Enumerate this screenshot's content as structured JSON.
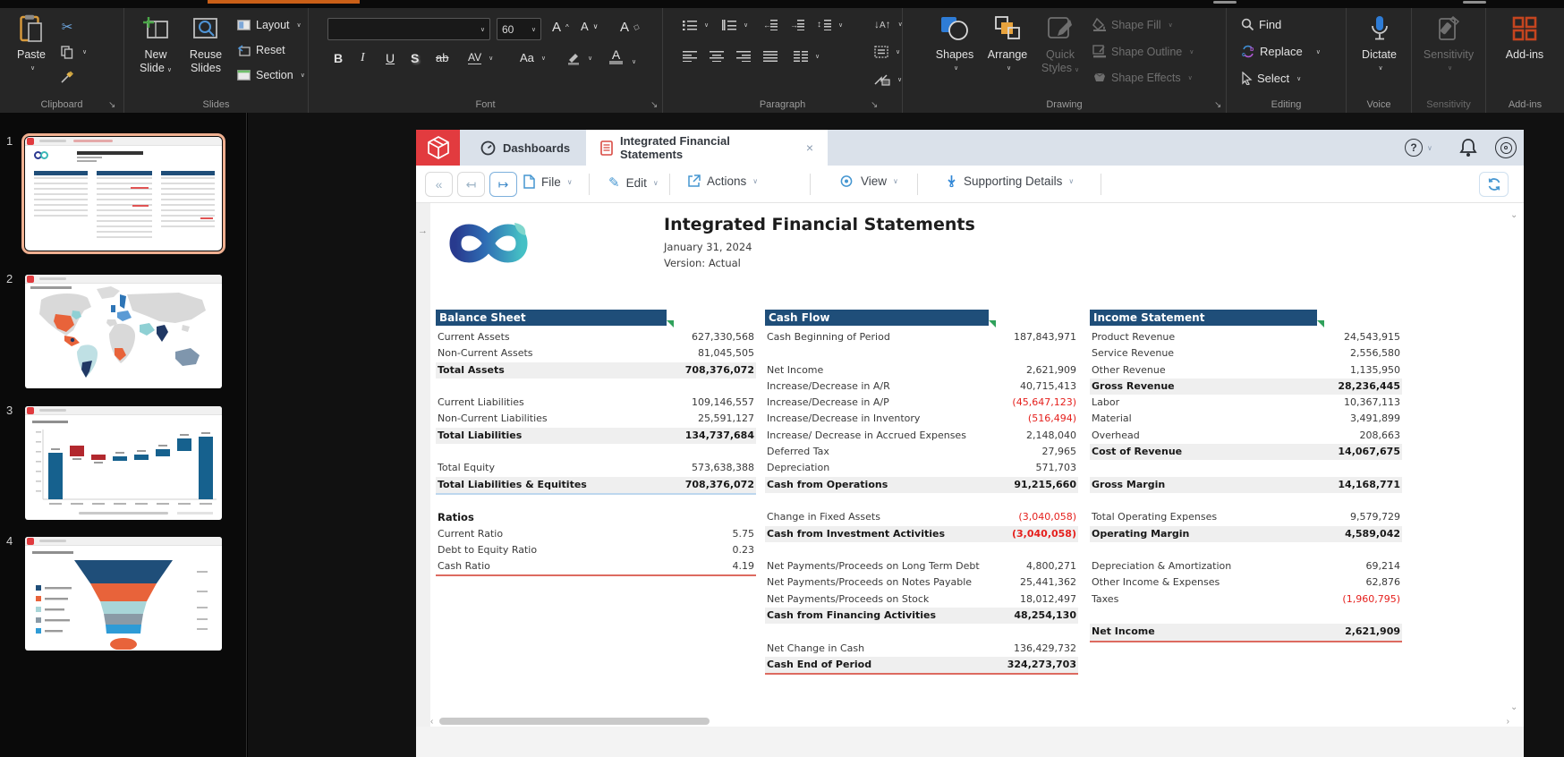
{
  "ribbon": {
    "clipboard": {
      "label": "Clipboard",
      "paste": "Paste"
    },
    "slides": {
      "label": "Slides",
      "new_slide_1": "New",
      "new_slide_2": "Slide",
      "reuse_1": "Reuse",
      "reuse_2": "Slides",
      "layout": "Layout",
      "reset": "Reset",
      "section": "Section"
    },
    "font": {
      "label": "Font",
      "font_name": "",
      "font_size": "60",
      "bold": "B",
      "italic": "I",
      "underline": "U",
      "shadow": "S",
      "strike": "ab",
      "spacing": "AV",
      "case": "Aa"
    },
    "paragraph": {
      "label": "Paragraph"
    },
    "drawing": {
      "label": "Drawing",
      "shapes": "Shapes",
      "arrange": "Arrange",
      "quick_1": "Quick",
      "quick_2": "Styles",
      "shape_fill": "Shape Fill",
      "shape_outline": "Shape Outline",
      "shape_effects": "Shape Effects"
    },
    "editing": {
      "label": "Editing",
      "find": "Find",
      "replace": "Replace",
      "select": "Select"
    },
    "voice": {
      "label": "Voice",
      "dictate": "Dictate"
    },
    "sensitivity": {
      "label": "Sensitivity",
      "button": "Sensitivity"
    },
    "addins": {
      "label": "Add-ins",
      "button": "Add-ins"
    }
  },
  "slide_panel": {
    "slides": [
      {
        "number": "1",
        "selected": true
      },
      {
        "number": "2",
        "selected": false
      },
      {
        "number": "3",
        "selected": false
      },
      {
        "number": "4",
        "selected": false
      }
    ]
  },
  "app": {
    "tabs": [
      {
        "label": "Dashboards"
      },
      {
        "label": "Integrated Financial Statements",
        "close": "×"
      }
    ],
    "toolbar": {
      "back": "«",
      "history_back": "↤",
      "history_forward": "↦",
      "file": "File",
      "edit": "Edit",
      "actions": "Actions",
      "view": "View",
      "supporting_details": "Supporting Details",
      "help": "?"
    },
    "document": {
      "title": "Integrated Financial Statements",
      "date": "January 31, 2024",
      "version": "Version: Actual",
      "statements": [
        {
          "css": "bs",
          "title": "Balance Sheet",
          "rows": [
            {
              "l": "Current Assets",
              "v": "627,330,568"
            },
            {
              "l": "Non-Current Assets",
              "v": "81,045,505"
            },
            {
              "l": "Total Assets",
              "v": "708,376,072",
              "t": 1
            },
            {
              "b": 1
            },
            {
              "l": "Current Liabilities",
              "v": "109,146,557"
            },
            {
              "l": "Non-Current Liabilities",
              "v": "25,591,127"
            },
            {
              "l": "Total Liabilities",
              "v": "134,737,684",
              "t": 1
            },
            {
              "b": 1
            },
            {
              "l": "Total Equity",
              "v": "573,638,388"
            },
            {
              "l": "Total Liabilities & Equitites",
              "v": "708,376,072",
              "t": 1,
              "u": "blue"
            },
            {
              "b": 1
            },
            {
              "l": "Ratios",
              "sub": 1
            },
            {
              "l": "Current Ratio",
              "v": "5.75"
            },
            {
              "l": "Debt to Equity Ratio",
              "v": "0.23"
            },
            {
              "l": "Cash Ratio",
              "v": "4.19",
              "u": "red"
            }
          ]
        },
        {
          "css": "cf",
          "title": "Cash Flow",
          "rows": [
            {
              "l": "Cash Beginning of Period",
              "v": "187,843,971"
            },
            {
              "b": 1
            },
            {
              "l": "Net Income",
              "v": "2,621,909"
            },
            {
              "l": "Increase/Decrease in A/R",
              "v": "40,715,413"
            },
            {
              "l": "Increase/Decrease in A/P",
              "v": "(45,647,123)",
              "neg": 1
            },
            {
              "l": "Increase/Decrease in Inventory",
              "v": "(516,494)",
              "neg": 1
            },
            {
              "l": "Increase/ Decrease in Accrued Expenses",
              "v": "2,148,040"
            },
            {
              "l": "Deferred Tax",
              "v": "27,965"
            },
            {
              "l": "Depreciation",
              "v": "571,703"
            },
            {
              "l": "Cash from Operations",
              "v": "91,215,660",
              "t": 1
            },
            {
              "b": 1
            },
            {
              "l": "Change in Fixed Assets",
              "v": "(3,040,058)",
              "neg": 1
            },
            {
              "l": "Cash from Investment Activities",
              "v": "(3,040,058)",
              "t": 1,
              "neg": 1
            },
            {
              "b": 1
            },
            {
              "l": "Net Payments/Proceeds on Long Term Debt",
              "v": "4,800,271"
            },
            {
              "l": "Net Payments/Proceeds on Notes Payable",
              "v": "25,441,362"
            },
            {
              "l": "Net Payments/Proceeds on Stock",
              "v": "18,012,497"
            },
            {
              "l": "Cash from Financing Activities",
              "v": "48,254,130",
              "t": 1
            },
            {
              "b": 1
            },
            {
              "l": "Net Change in Cash",
              "v": "136,429,732"
            },
            {
              "l": "Cash End of Period",
              "v": "324,273,703",
              "t": 1,
              "u": "red"
            }
          ]
        },
        {
          "css": "is",
          "title": "Income Statement",
          "rows": [
            {
              "l": "Product Revenue",
              "v": "24,543,915"
            },
            {
              "l": "Service Revenue",
              "v": "2,556,580"
            },
            {
              "l": "Other Revenue",
              "v": "1,135,950"
            },
            {
              "l": "Gross Revenue",
              "v": "28,236,445",
              "t": 1
            },
            {
              "l": "Labor",
              "v": "10,367,113"
            },
            {
              "l": "Material",
              "v": "3,491,899"
            },
            {
              "l": "Overhead",
              "v": "208,663"
            },
            {
              "l": "Cost of Revenue",
              "v": "14,067,675",
              "t": 1
            },
            {
              "b": 1
            },
            {
              "l": "Gross Margin",
              "v": "14,168,771",
              "t": 1
            },
            {
              "b": 1
            },
            {
              "l": "Total Operating Expenses",
              "v": "9,579,729"
            },
            {
              "l": "Operating Margin",
              "v": "4,589,042",
              "t": 1
            },
            {
              "b": 1
            },
            {
              "l": "Depreciation & Amortization",
              "v": "69,214"
            },
            {
              "l": "Other Income & Expenses",
              "v": "62,876"
            },
            {
              "l": "Taxes",
              "v": "(1,960,795)",
              "neg": 1
            },
            {
              "b": 1
            },
            {
              "l": "Net Income",
              "v": "2,621,909",
              "t": 1,
              "u": "red"
            }
          ]
        }
      ]
    }
  },
  "colors": {
    "accent_orange": "#c95f17",
    "ribbon_bg": "#262626",
    "header_bar_blue": "#1f4e79",
    "negative_red": "#e5201d",
    "app_header": "#dae1ea",
    "logo_red": "#e23b3f",
    "total_row_gray": "#efefef",
    "addin_orange": "#c5451f",
    "comment_green": "#2fa15b"
  }
}
